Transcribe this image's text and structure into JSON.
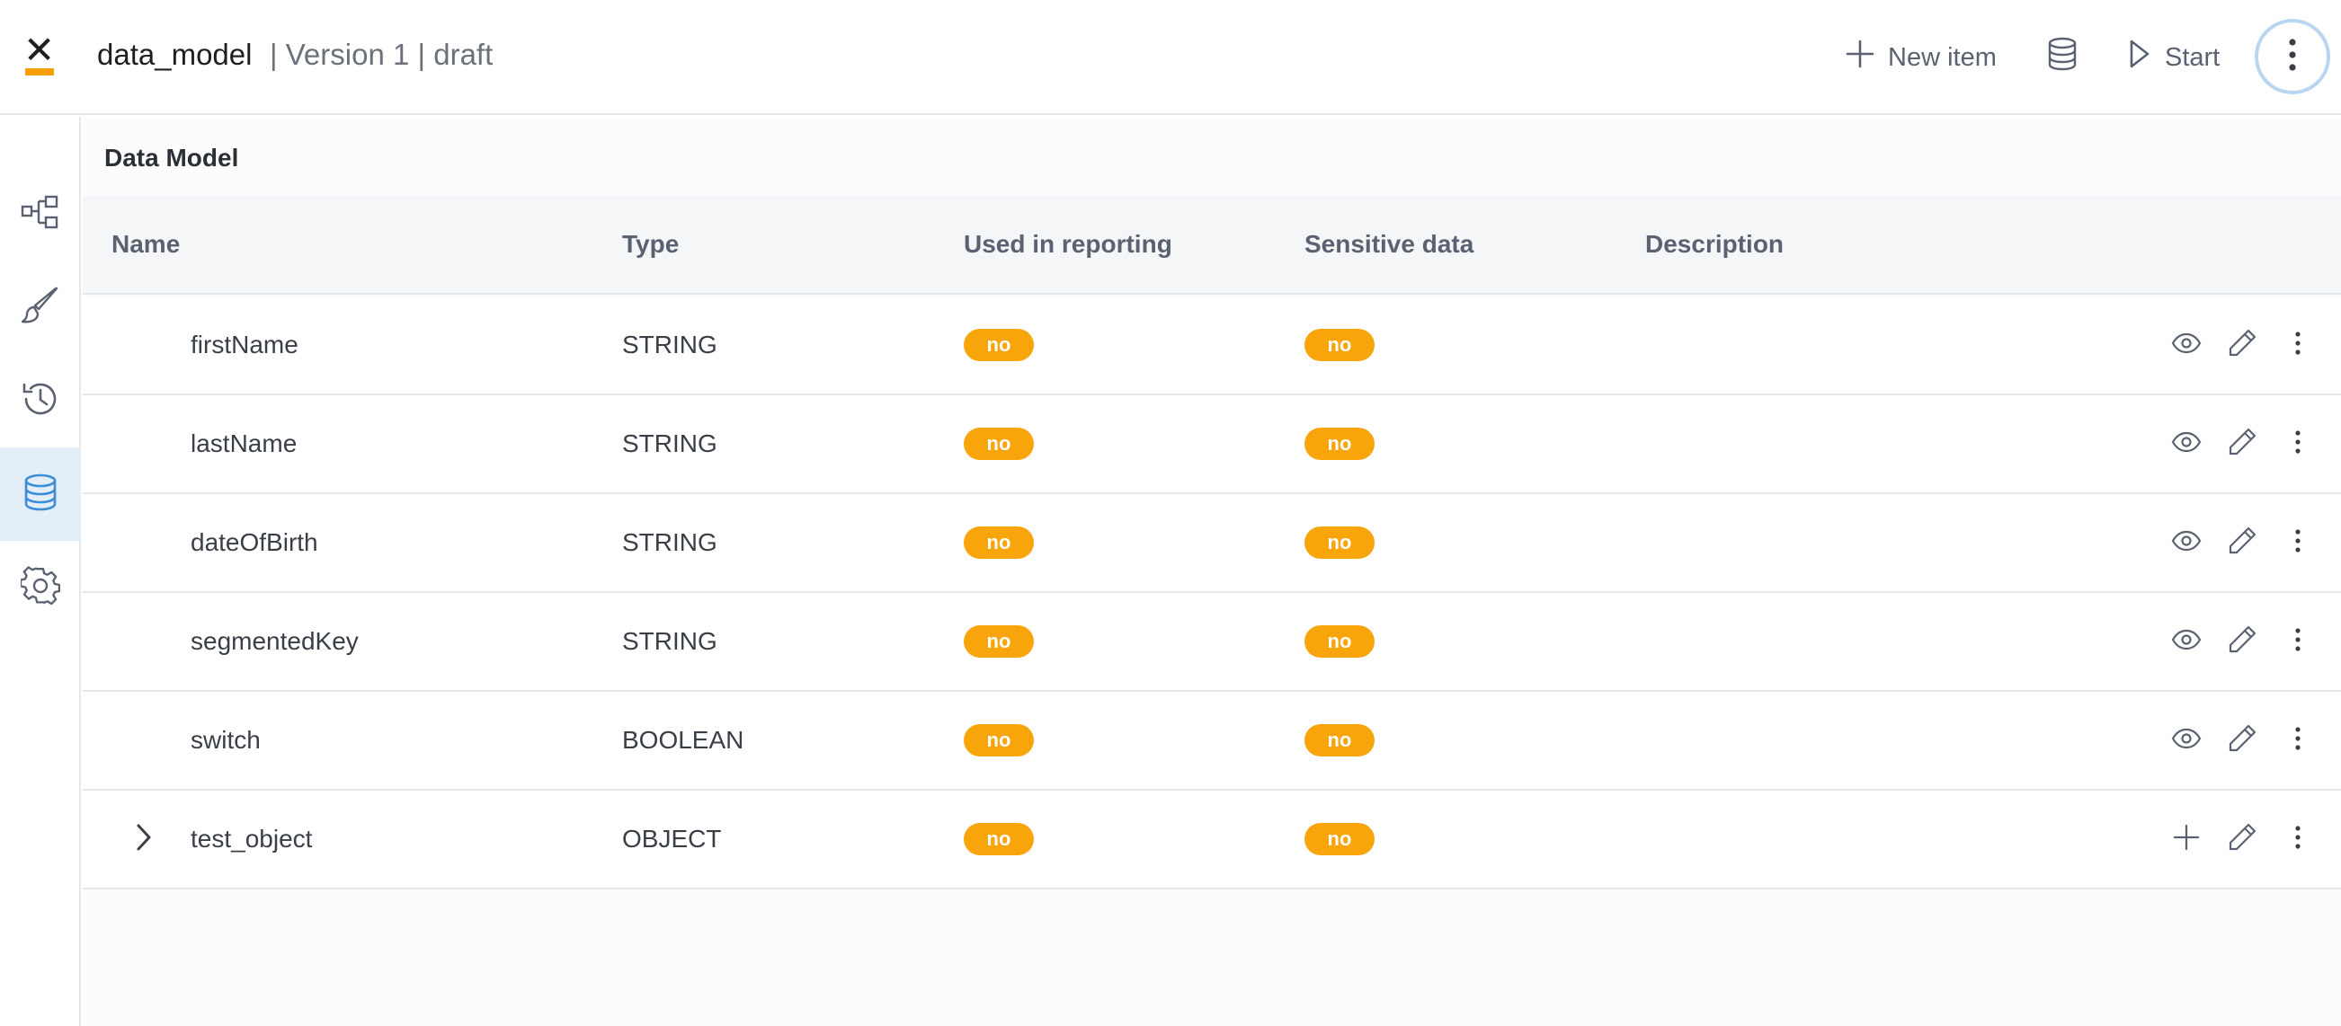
{
  "header": {
    "app_title": "data_model",
    "version_text": "| Version 1 | draft",
    "new_item_label": "New item",
    "start_label": "Start"
  },
  "sidebar": {
    "items": [
      {
        "icon": "process-flow-icon"
      },
      {
        "icon": "brush-icon"
      },
      {
        "icon": "history-icon"
      },
      {
        "icon": "database-icon",
        "active": true
      },
      {
        "icon": "gear-icon"
      }
    ]
  },
  "main": {
    "title": "Data Model",
    "columns": [
      "Name",
      "Type",
      "Used in reporting",
      "Sensitive data",
      "Description"
    ],
    "rows": [
      {
        "name": "firstName",
        "type": "STRING",
        "reporting": "no",
        "sensitive": "no"
      },
      {
        "name": "lastName",
        "type": "STRING",
        "reporting": "no",
        "sensitive": "no"
      },
      {
        "name": "dateOfBirth",
        "type": "STRING",
        "reporting": "no",
        "sensitive": "no"
      },
      {
        "name": "segmentedKey",
        "type": "STRING",
        "reporting": "no",
        "sensitive": "no"
      },
      {
        "name": "switch",
        "type": "BOOLEAN",
        "reporting": "no",
        "sensitive": "no"
      },
      {
        "name": "test_object",
        "type": "OBJECT",
        "reporting": "no",
        "sensitive": "no"
      }
    ]
  },
  "colors": {
    "accent": "#f5a007",
    "badge": "#f8a50b",
    "active_bg": "#e4eef8",
    "active_icon": "#3b8ed6"
  }
}
